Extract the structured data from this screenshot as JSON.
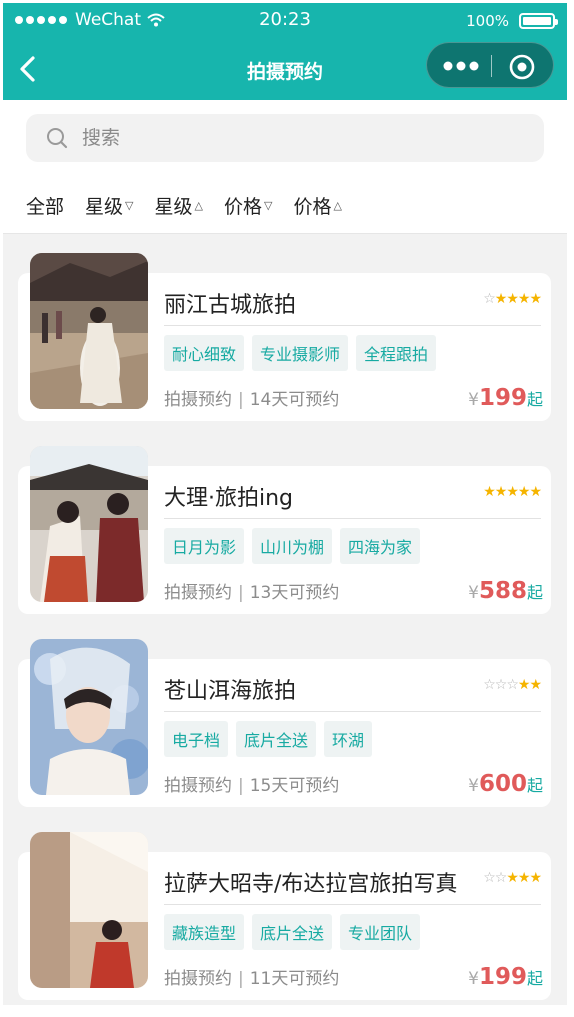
{
  "status_bar": {
    "carrier": "WeChat",
    "time": "20:23",
    "battery": "100%",
    "battery_level": 1.0
  },
  "nav": {
    "title": "拍摄预约",
    "back_icon": "chevron-left-icon",
    "more_icon": "more-dots-icon",
    "close_icon": "target-close-icon"
  },
  "search": {
    "placeholder": "搜索",
    "value": ""
  },
  "filters": [
    {
      "label": "全部",
      "indicator": ""
    },
    {
      "label": "星级",
      "indicator": "▽"
    },
    {
      "label": "星级",
      "indicator": "△"
    },
    {
      "label": "价格",
      "indicator": "▽"
    },
    {
      "label": "价格",
      "indicator": "△"
    }
  ],
  "colors": {
    "brand": "#17b5ad",
    "price": "#e05a5a",
    "star": "#f5b400"
  },
  "cards": [
    {
      "name": "丽江古城旅拍",
      "rating": 4,
      "tags": [
        "耐心细致",
        "专业摄影师",
        "全程跟拍"
      ],
      "meta_label": "拍摄预约",
      "meta_sep": "|",
      "availability": "14天可预约",
      "currency": "¥",
      "price": "199",
      "price_suffix": "起"
    },
    {
      "name": "大理·旅拍ing",
      "rating": 5,
      "tags": [
        "日月为影",
        "山川为棚",
        "四海为家"
      ],
      "meta_label": "拍摄预约",
      "meta_sep": "|",
      "availability": "13天可预约",
      "currency": "¥",
      "price": "588",
      "price_suffix": "起"
    },
    {
      "name": "苍山洱海旅拍",
      "rating": 2,
      "tags": [
        "电子档",
        "底片全送",
        "环湖"
      ],
      "meta_label": "拍摄预约",
      "meta_sep": "|",
      "availability": "15天可预约",
      "currency": "¥",
      "price": "600",
      "price_suffix": "起"
    },
    {
      "name": "拉萨大昭寺/布达拉宫旅拍写真",
      "rating": 3,
      "tags": [
        "藏族造型",
        "底片全送",
        "专业团队"
      ],
      "meta_label": "拍摄预约",
      "meta_sep": "|",
      "availability": "11天可预约",
      "currency": "¥",
      "price": "199",
      "price_suffix": "起"
    }
  ]
}
